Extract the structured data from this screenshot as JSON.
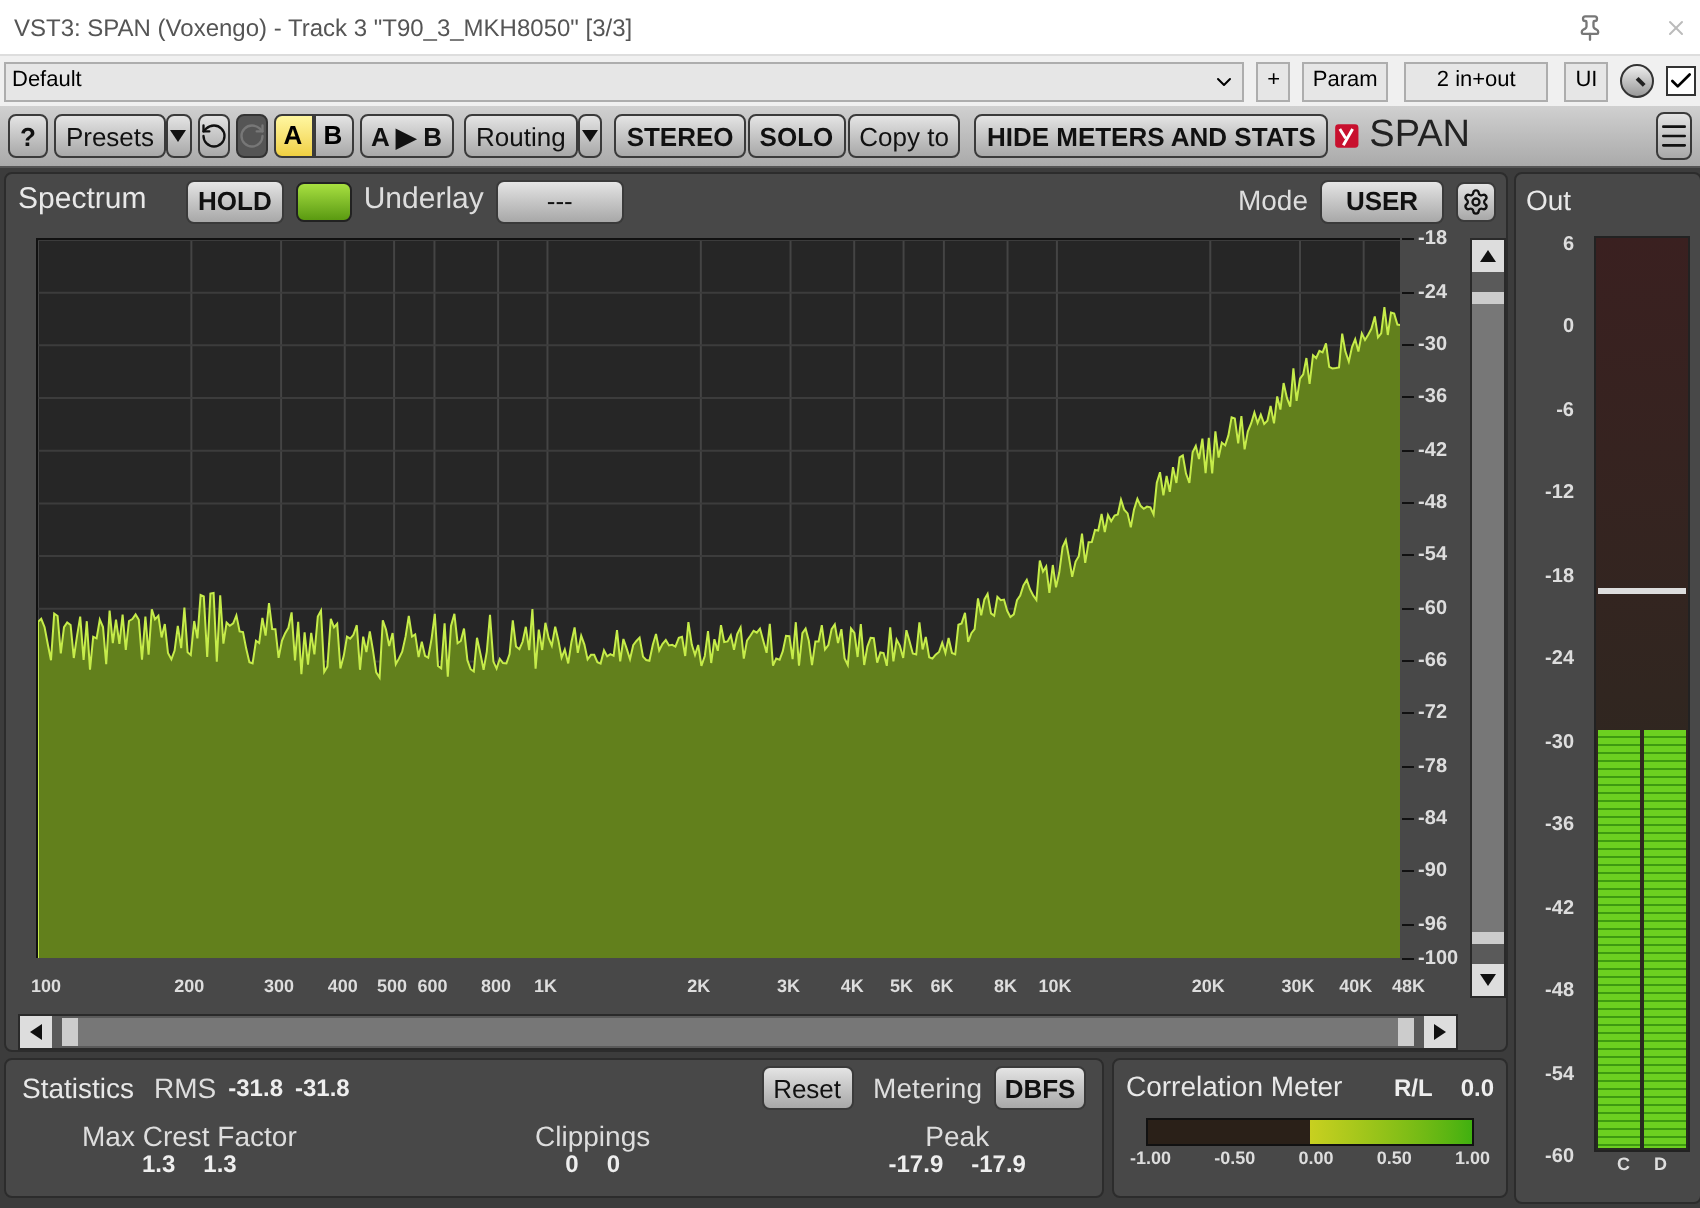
{
  "window": {
    "title": "VST3: SPAN (Voxengo) - Track 3 \"T90_3_MKH8050\" [3/3]"
  },
  "preset_bar": {
    "preset": "Default",
    "add": "+",
    "param": "Param",
    "routing_mode": "2 in+out",
    "ui": "UI",
    "enabled": true
  },
  "toolbar": {
    "help": "?",
    "presets": "Presets",
    "ab": [
      {
        "label": "A",
        "selected": true
      },
      {
        "label": "B",
        "selected": false
      }
    ],
    "a_to_b": "A ▶ B",
    "routing": "Routing",
    "stereo": "STEREO",
    "solo": "SOLO",
    "copy_to": "Copy to",
    "hide_meters": "HIDE METERS AND STATS",
    "logo": "SPAN"
  },
  "spectrum": {
    "title": "Spectrum",
    "hold": "HOLD",
    "hold_led_on": true,
    "underlay_label": "Underlay",
    "underlay_value": "---",
    "mode_label": "Mode",
    "mode_value": "USER",
    "db_labels": [
      "-18",
      "-24",
      "-30",
      "-36",
      "-42",
      "-48",
      "-54",
      "-60",
      "-66",
      "-72",
      "-78",
      "-84",
      "-90",
      "-96",
      "-100"
    ],
    "freq_labels": [
      "100",
      "200",
      "300",
      "400",
      "500",
      "600",
      "800",
      "1K",
      "2K",
      "3K",
      "4K",
      "5K",
      "6K",
      "8K",
      "10K",
      "20K",
      "30K",
      "40K",
      "48K"
    ]
  },
  "statistics": {
    "title": "Statistics",
    "rms_label": "RMS",
    "rms_values": [
      "-31.8",
      "-31.8"
    ],
    "reset": "Reset",
    "metering_label": "Metering",
    "metering_value": "DBFS",
    "groups": [
      {
        "label": "Max Crest Factor",
        "values": [
          "1.3",
          "1.3"
        ]
      },
      {
        "label": "Clippings",
        "values": [
          "0",
          "0"
        ]
      },
      {
        "label": "Peak",
        "values": [
          "-17.9",
          "-17.9"
        ]
      }
    ]
  },
  "correlation": {
    "title": "Correlation Meter",
    "channel_label": "R/L",
    "reading": "0.0",
    "level": 0.5,
    "scale": [
      "-1.00",
      "-0.50",
      "0.00",
      "0.50",
      "1.00"
    ]
  },
  "out": {
    "title": "Out",
    "scale": [
      "6",
      "0",
      "-6",
      "-12",
      "-18",
      "-24",
      "-30",
      "-36",
      "-42",
      "-48",
      "-54",
      "-60"
    ],
    "channels": [
      {
        "name": "C",
        "level": 0.46
      },
      {
        "name": "D",
        "level": 0.46
      }
    ],
    "peak_hold": {
      "level": 0.61
    }
  }
}
